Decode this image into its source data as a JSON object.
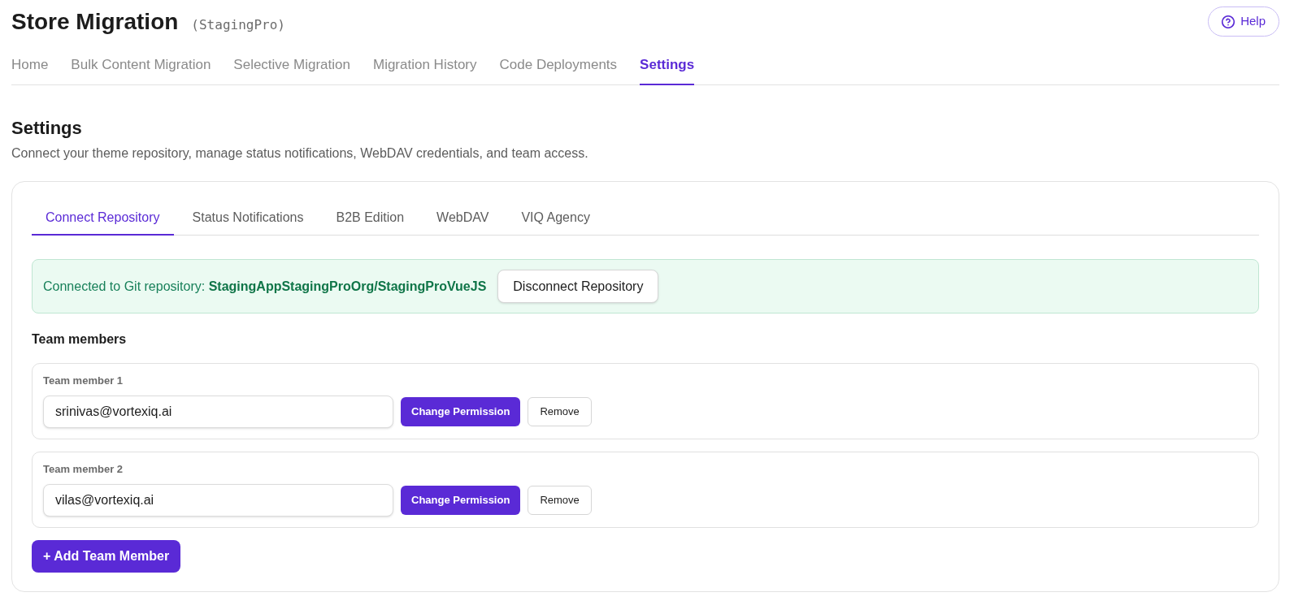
{
  "header": {
    "title": "Store Migration",
    "subtitle": "(StagingPro)",
    "help_button": "Help"
  },
  "nav_tabs": [
    {
      "label": "Home",
      "selected": false
    },
    {
      "label": "Bulk Content Migration",
      "selected": false
    },
    {
      "label": "Selective Migration",
      "selected": false
    },
    {
      "label": "Migration History",
      "selected": false
    },
    {
      "label": "Code Deployments",
      "selected": false
    },
    {
      "label": "Settings",
      "selected": true
    }
  ],
  "section": {
    "title": "Settings",
    "description": "Connect your theme repository, manage status notifications, WebDAV credentials, and team access."
  },
  "settings_tabs": [
    {
      "label": "Connect Repository",
      "selected": true
    },
    {
      "label": "Status Notifications",
      "selected": false
    },
    {
      "label": "B2B Edition",
      "selected": false
    },
    {
      "label": "WebDAV",
      "selected": false
    },
    {
      "label": "VIQ Agency",
      "selected": false
    }
  ],
  "repository_banner": {
    "text": "Connected to Git repository: **StagingAppStagingProOrg/StagingProVueJS**",
    "button": "Disconnect Repository"
  },
  "team": {
    "title": "Team members",
    "members": [
      {
        "label": "Team member 1",
        "value": "srinivas@vortexiq.ai",
        "change_button": "Change Permission",
        "remove_button": "Remove"
      },
      {
        "label": "Team member 2",
        "value": "vilas@vortexiq.ai",
        "change_button": "Change Permission",
        "remove_button": "Remove"
      }
    ],
    "add_button": "+ Add Team Member"
  }
}
